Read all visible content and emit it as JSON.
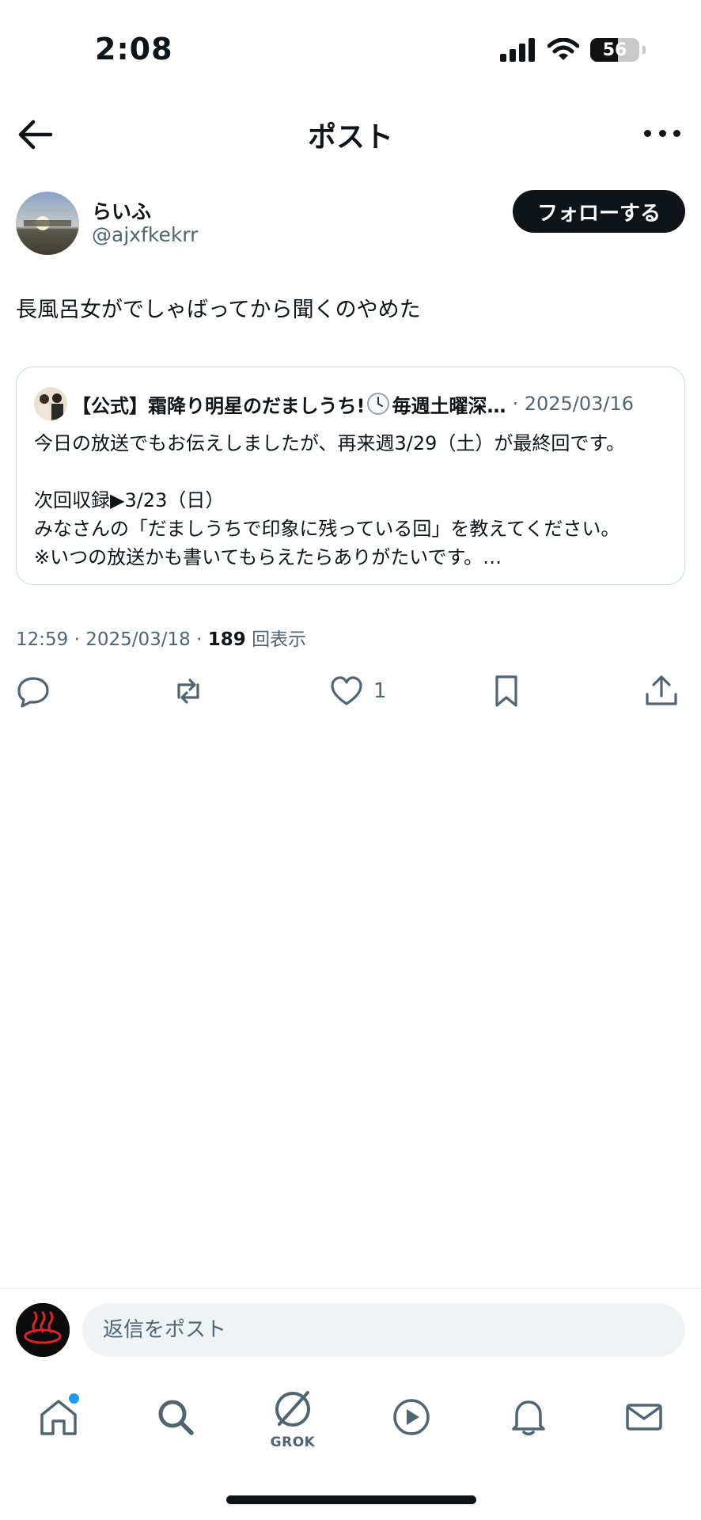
{
  "status_bar": {
    "time": "2:08",
    "battery": "56"
  },
  "header": {
    "title": "ポスト"
  },
  "author": {
    "name": "らいふ",
    "handle": "@ajxfkekrr",
    "follow_label": "フォローする"
  },
  "post": {
    "text": "長風呂女がでしゃばってから聞くのやめた"
  },
  "quote": {
    "name": "【公式】霜降り明星のだましうち!",
    "name_suffix": "毎週土曜深…",
    "date": "· 2025/03/16",
    "lines": [
      "今日の放送でもお伝えしましたが、再来週3/29（土）が最終回です。",
      "次回収録▶3/23（日）",
      "みなさんの「だましうちで印象に残っている回」を教えてください。",
      "※いつの放送かも書いてもらえたらありがたいです。…"
    ]
  },
  "meta": {
    "time": "12:59",
    "date": "2025/03/18",
    "views_count": "189",
    "views_label": "回表示"
  },
  "actions": {
    "like_count": "1"
  },
  "reply": {
    "placeholder": "返信をポスト"
  },
  "nav": {
    "grok_label": "GROK"
  },
  "colors": {
    "accent": "#1d9bf0",
    "text": "#0f1419",
    "secondary": "#536471",
    "border": "#cfd9de"
  }
}
